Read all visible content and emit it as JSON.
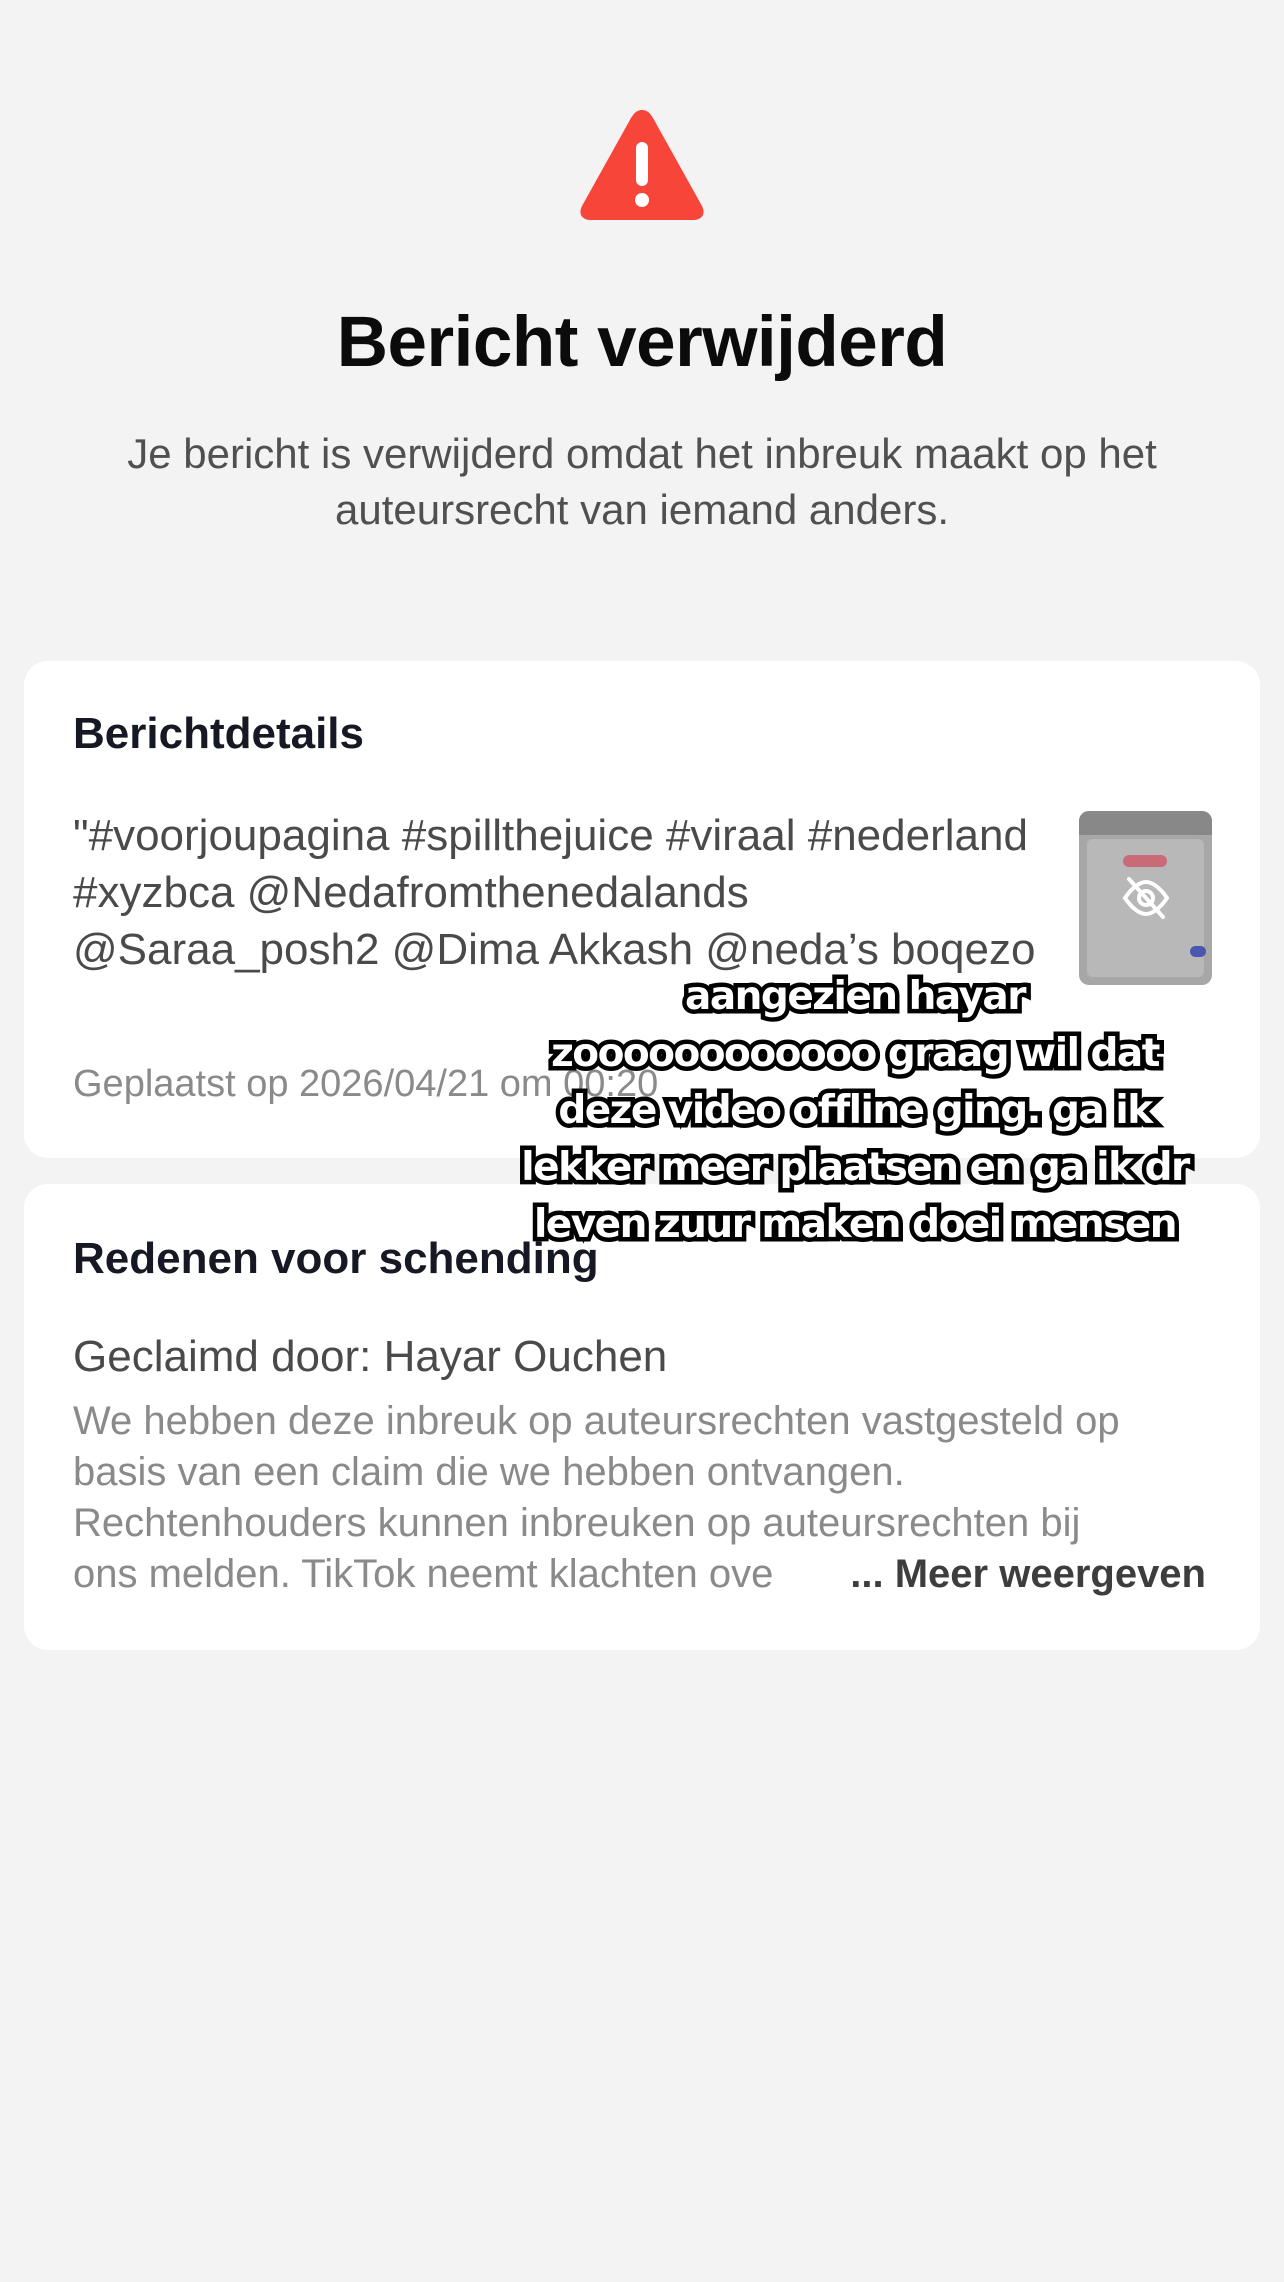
{
  "header": {
    "icon": "warning-triangle-icon",
    "icon_color": "#f7453a",
    "title": "Bericht verwijderd",
    "description": "Je bericht is verwijderd omdat het inbreuk maakt op het auteursrecht van iemand anders."
  },
  "details": {
    "heading": "Berichtdetails",
    "caption": "\"#voorjoupagina #spillthejuice #viraal #nederland #xyzbca @Nedafromthenedalands @Saraa_posh2 @Dima Akkash @neda’s boqezo",
    "posted": "Geplaatst op 2026/04/21 om 00:20",
    "thumbnail_icon": "eye-off-icon"
  },
  "reasons": {
    "heading": "Redenen voor schending",
    "claimed_by": "Geclaimd door: Hayar Ouchen",
    "text_lines": [
      "We hebben deze inbreuk op auteursrechten vastgesteld op",
      "basis van een claim die we hebben ontvangen.",
      "Rechtenhouders kunnen inbreuken op auteursrechten bij",
      "ons melden. TikTok neemt klachten ove"
    ],
    "more_label": "... Meer weergeven"
  },
  "overlay": {
    "text": "aangezien hayar zoooooooooooo graag wil dat deze video offline ging. ga ik lekker meer plaatsen en ga ik dr leven zuur maken doei mensen"
  }
}
